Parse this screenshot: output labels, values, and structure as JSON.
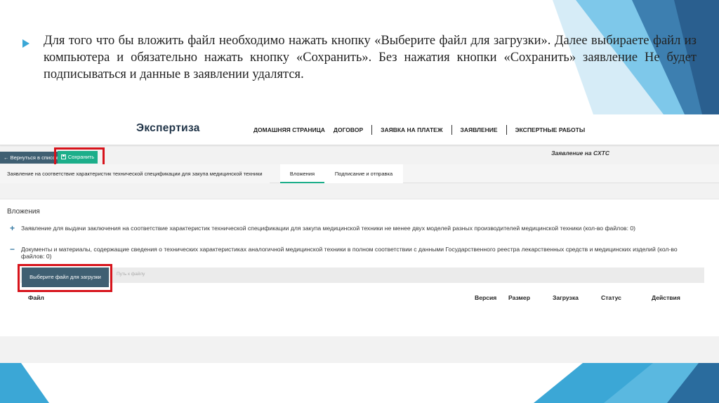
{
  "slide": {
    "bullet_text": "Для того что бы вложить файл необходимо нажать кнопку «Выберите файл для загрузки». Далее выбираете файл из компьютера и обязательно нажать кнопку «Сохранить». Без нажатия кнопки «Сохранить» заявление Не будет подписываться и данные в заявлении удалятся.",
    "accent_color": "#3ba7d6"
  },
  "app": {
    "logo": "Экспертиза",
    "nav": [
      "ДОМАШНЯЯ СТРАНИЦА",
      "ДОГОВОР",
      "ЗАЯВКА НА ПЛАТЕЖ",
      "ЗАЯВЛЕНИЕ",
      "ЭКСПЕРТНЫЕ РАБОТЫ"
    ],
    "toolbar": {
      "back_label": "← Вернуться в список",
      "save_label": "Сохранить",
      "save_icon": "floppy-icon"
    },
    "title": "Заявление на СХТС",
    "tabs": [
      {
        "label": "Заявление на соответствие характеристик технической спецификации для закупа медицинской техники",
        "active": false
      },
      {
        "label": "Вложения",
        "active": true
      },
      {
        "label": "Подписание и отправка",
        "active": false
      }
    ],
    "attachments": {
      "section_title": "Вложения",
      "items": [
        {
          "sign": "+",
          "text": "Заявление для выдачи заключения на соответствие характеристик технической спецификации для закупа медицинской техники не менее двух моделей разных производителей медицинской техники (кол-во файлов: 0)"
        },
        {
          "sign": "−",
          "text": "Документы и материалы, содержащие сведения о технических характеристиках аналогичной медицинской техники в полном соответствии с данными Государственного реестра лекарственных средств и медицинских изделий (кол-во файлов: 0)"
        }
      ],
      "upload_button": "Выберите файл для загрузки",
      "path_placeholder": "Путь к файлу",
      "columns": [
        "Файл",
        "Версия",
        "Размер",
        "Загрузка",
        "Статус",
        "Действия"
      ]
    },
    "highlight_color": "#d7131b"
  }
}
